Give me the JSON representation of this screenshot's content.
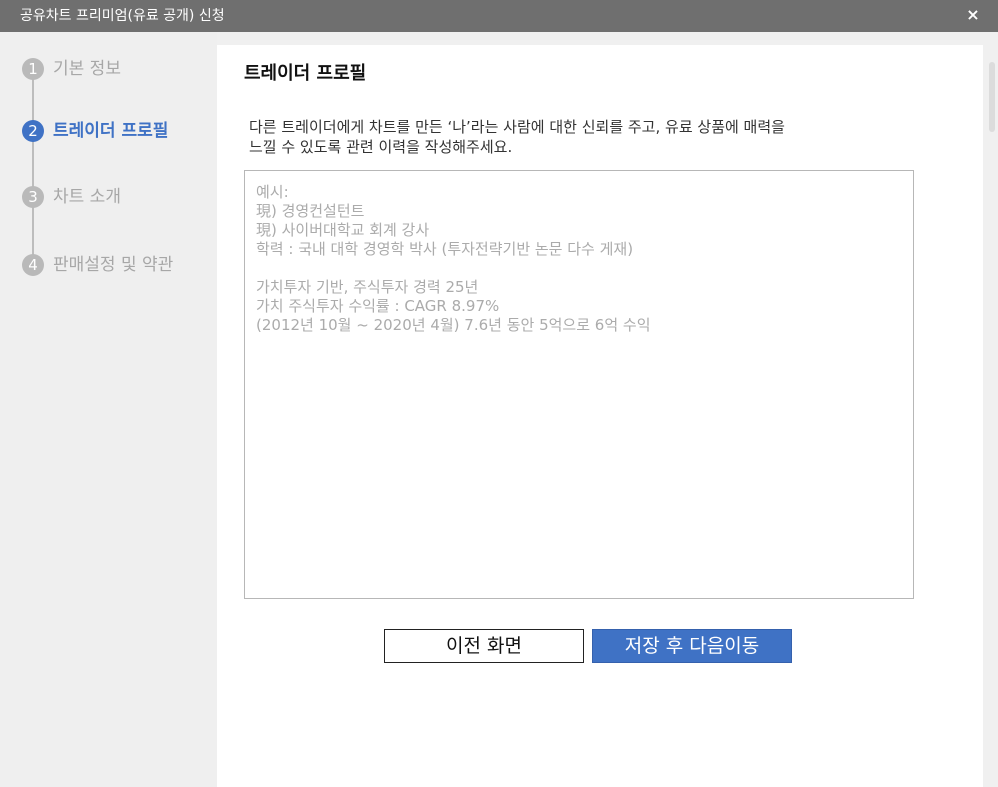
{
  "window": {
    "title": "공유차트 프리미엄(유료 공개) 신청",
    "close_label": "×"
  },
  "steps": [
    {
      "number": "1",
      "label": "기본 정보",
      "active": false
    },
    {
      "number": "2",
      "label": "트레이더 프로필",
      "active": true
    },
    {
      "number": "3",
      "label": "차트 소개",
      "active": false
    },
    {
      "number": "4",
      "label": "판매설정 및 약관",
      "active": false
    }
  ],
  "main": {
    "title": "트레이더 프로필",
    "description_lines": [
      "다른 트레이더에게 차트를 만든 ‘나’라는 사람에 대한 신뢰를 주고, 유료 상품에 매력을",
      "느낄 수 있도록 관련 이력을 작성해주세요."
    ],
    "profile_input": {
      "value": "",
      "placeholder_lines": [
        "예시:",
        "現) 경영컨설턴트",
        "現) 사이버대학교 회계 강사",
        "학력 : 국내 대학 경영학 박사 (투자전략기반 논문 다수 게재)",
        "",
        "가치투자 기반, 주식투자 경력 25년",
        "가치 주식투자 수익률 : CAGR 8.97%",
        "(2012년 10월 ~ 2020년 4월) 7.6년 동안 5억으로 6억 수익"
      ]
    },
    "buttons": {
      "prev_label": "이전 화면",
      "next_label": "저장 후 다음이동"
    }
  },
  "colors": {
    "accent": "#3f72c5",
    "titlebar": "#6f6f6f",
    "inactive_step": "#b9b9b9"
  }
}
